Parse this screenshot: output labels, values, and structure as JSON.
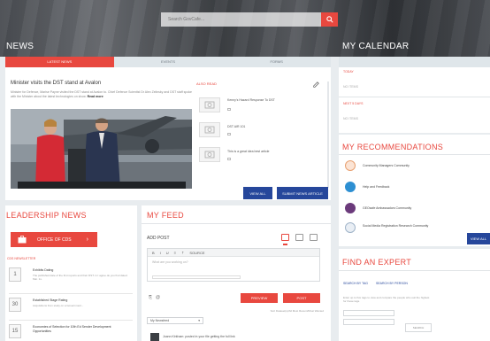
{
  "search": {
    "placeholder": "Search GovCafe..."
  },
  "news": {
    "title": "NEWS",
    "tabs": [
      "LATEST NEWS",
      "EVENTS",
      "FORMS"
    ],
    "article_title": "Minister visits the DST stand at Avalon",
    "article_text": "Minister for Defence, Marise Payne visited the DST stand at Avalon to. Chief Defence Scientist Dr Alex Zelinsky and DST staff spoke with the Minister about the latest technologies on show.",
    "read_more": "Read more",
    "also_read": "ALSO READ",
    "also_items": [
      "Kenny's Hazard Response To DST",
      "DST AIR 101",
      "This is a great idea best article"
    ],
    "view_all": "VIEW ALL",
    "submit": "SUBMIT NEWS ARTICLE"
  },
  "calendar": {
    "title": "MY CALENDAR",
    "today": "TODAY",
    "no_items": "NO ITEMS",
    "week": "NEXT 5 DAYS",
    "no_items_2": "NO ITEMS"
  },
  "recommendations": {
    "title": "MY RECOMMENDATIONS",
    "items": [
      "Community Managers Community",
      "Help and Feedback",
      "GEOsafe Ambassadors Community",
      "Social Media Registration Research Community"
    ],
    "view_all": "VIEW ALL"
  },
  "expert": {
    "title": "FIND AN EXPERT",
    "search_by": "SEARCH BY TAG",
    "search_person": "SEARCH BY PERSON",
    "desc": "Enter up to five tags to view and compare the people who suit the highest for these tags.",
    "button": "SEARCH"
  },
  "leadership": {
    "title": "LEADERSHIP NEWS",
    "office": "OFFICE OF CDS",
    "sub": "CDS NEWSLETTER",
    "items": [
      {
        "day": "1",
        "title": "Exhibits Dating",
        "text": "The published date of the first reports and their DST. in I agree do you find dated Mar. 1s."
      },
      {
        "day": "30",
        "title": "Established Stage Rating",
        "text": "Acquisitions from study on a Government..."
      },
      {
        "day": "15",
        "title": "Economies of Selection for 10th Ed Sender Development Opportunities",
        "text": ""
      }
    ]
  },
  "feed": {
    "title": "MY FEED",
    "add_post": "ADD POST",
    "toolbar": [
      "B",
      "I",
      "U",
      "≡",
      "⇡",
      "SOURCE"
    ],
    "editor_placeholder": "What are you working on?",
    "preview": "PREVIEW",
    "post": "POST",
    "filter": "My Newsfeed",
    "post_text": "Sort Dataset(s)/All Most Recent/Most Wanted",
    "first_item": "Joann Kirkham: posted in your file getting the full link"
  }
}
